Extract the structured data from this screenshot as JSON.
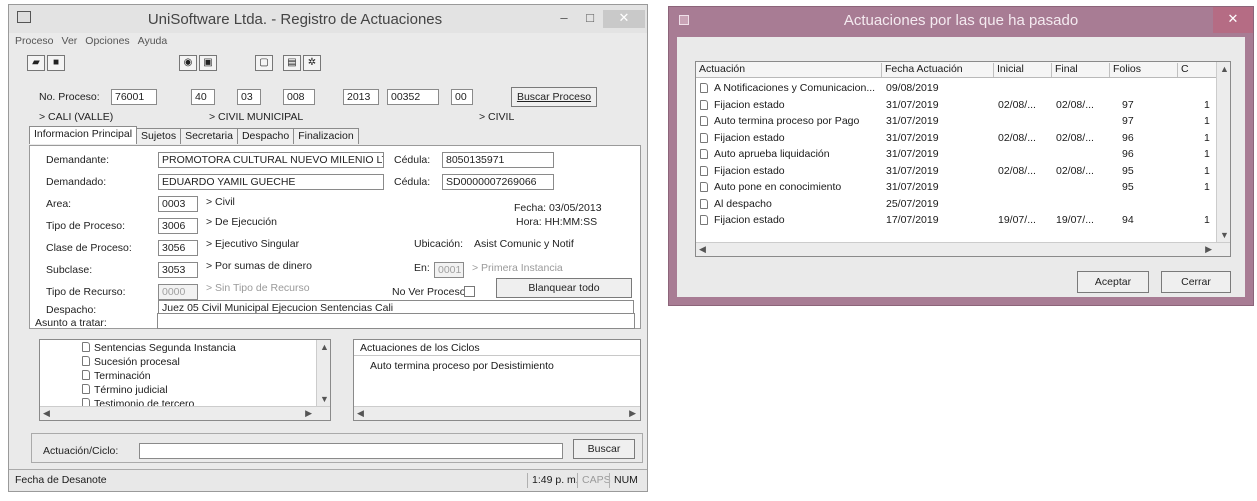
{
  "main_window": {
    "title": "UniSoftware Ltda. - Registro de Actuaciones",
    "menu": [
      "Proceso",
      "Ver",
      "Opciones",
      "Ayuda"
    ],
    "no_proceso_label": "No. Proceso:",
    "proceso_parts": [
      "76001",
      "40",
      "03",
      "008",
      "2013",
      "00352",
      "00"
    ],
    "buscar_proceso": "Buscar Proceso",
    "loc_city": "> CALI (VALLE)",
    "loc_court": "> CIVIL MUNICIPAL",
    "loc_area": "> CIVIL",
    "tabs": [
      "Informacion Principal",
      "Sujetos",
      "Secretaria",
      "Despacho",
      "Finalizacion"
    ],
    "demandante_label": "Demandante:",
    "demandante_value": "PROMOTORA CULTURAL NUEVO MILENIO LT",
    "cedula_label": "Cédula:",
    "cedula1_value": "8050135971",
    "demandado_label": "Demandado:",
    "demandado_value": "EDUARDO YAMIL GUECHE",
    "cedula2_value": "SD0000007269066",
    "area_label": "Area:",
    "area_code": "0003",
    "area_desc": "> Civil",
    "fecha_line": "Fecha: 03/05/2013",
    "hora_line": "Hora:    HH:MM:SS",
    "tipo_proceso_label": "Tipo de Proceso:",
    "tipo_proceso_code": "3006",
    "tipo_proceso_desc": "> De Ejecución",
    "clase_proceso_label": "Clase de Proceso:",
    "clase_proceso_code": "3056",
    "clase_proceso_desc": "> Ejecutivo Singular",
    "ubicacion_label": "Ubicación:",
    "ubicacion_value": "Asist Comunic y Notif",
    "subclase_label": "Subclase:",
    "subclase_code": "3053",
    "subclase_desc": "> Por sumas de dinero",
    "en_label": "En:",
    "en_code": "0001",
    "en_desc": "> Primera Instancia",
    "tipo_recurso_label": "Tipo de Recurso:",
    "tipo_recurso_code": "0000",
    "tipo_recurso_desc": "> Sin Tipo de Recurso",
    "no_ver_proceso_label": "No Ver Proceso:",
    "blanquear_button": "Blanquear todo",
    "despacho_label": "Despacho:",
    "despacho_value": "Juez 05 Civil Municipal Ejecucion Sentencias Cali",
    "asunto_label": "Asunto a tratar:",
    "tree_items": [
      "Sentencias Segunda Instancia",
      "Sucesión procesal",
      "Terminación",
      "Término judicial",
      "Testimonio de tercero"
    ],
    "ciclos_title": "Actuaciones de los Ciclos",
    "ciclos_item": "Auto termina proceso por Desistimiento",
    "actuacion_label": "Actuación/Ciclo:",
    "buscar_button": "Buscar",
    "status_left": "Fecha de Desanote",
    "status_time": "1:49 p. m.",
    "status_caps": "CAPS",
    "status_num": "NUM"
  },
  "dialog": {
    "title": "Actuaciones por las que ha pasado",
    "columns": [
      "Actuación",
      "Fecha Actuación",
      "Inicial",
      "Final",
      "Folios",
      "C"
    ],
    "rows": [
      {
        "actuacion": "A Notificaciones y Comunicacion...",
        "fecha": "09/08/2019",
        "inicial": "",
        "final": "",
        "folios": "",
        "c": ""
      },
      {
        "actuacion": "Fijacion estado",
        "fecha": "31/07/2019",
        "inicial": "02/08/...",
        "final": "02/08/...",
        "folios": "97",
        "c": "1"
      },
      {
        "actuacion": "Auto termina proceso por Pago",
        "fecha": "31/07/2019",
        "inicial": "",
        "final": "",
        "folios": "97",
        "c": "1"
      },
      {
        "actuacion": "Fijacion estado",
        "fecha": "31/07/2019",
        "inicial": "02/08/...",
        "final": "02/08/...",
        "folios": "96",
        "c": "1"
      },
      {
        "actuacion": "Auto aprueba liquidación",
        "fecha": "31/07/2019",
        "inicial": "",
        "final": "",
        "folios": "96",
        "c": "1"
      },
      {
        "actuacion": "Fijacion estado",
        "fecha": "31/07/2019",
        "inicial": "02/08/...",
        "final": "02/08/...",
        "folios": "95",
        "c": "1"
      },
      {
        "actuacion": "Auto pone en conocimiento",
        "fecha": "31/07/2019",
        "inicial": "",
        "final": "",
        "folios": "95",
        "c": "1"
      },
      {
        "actuacion": "Al despacho",
        "fecha": "25/07/2019",
        "inicial": "",
        "final": "",
        "folios": "",
        "c": ""
      },
      {
        "actuacion": "Fijacion estado",
        "fecha": "17/07/2019",
        "inicial": "19/07/...",
        "final": "19/07/...",
        "folios": "94",
        "c": "1"
      }
    ],
    "aceptar_button": "Aceptar",
    "cerrar_button": "Cerrar"
  }
}
